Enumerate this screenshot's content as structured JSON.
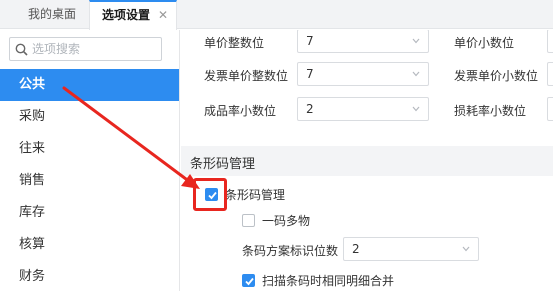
{
  "tabs": {
    "home_label": "我的桌面",
    "active_label": "选项设置",
    "close_glyph": "✕"
  },
  "sidebar": {
    "search_placeholder": "选项搜索",
    "items": [
      {
        "label": "公共",
        "active": true
      },
      {
        "label": "采购",
        "active": false
      },
      {
        "label": "往来",
        "active": false
      },
      {
        "label": "销售",
        "active": false
      },
      {
        "label": "库存",
        "active": false
      },
      {
        "label": "核算",
        "active": false
      },
      {
        "label": "财务",
        "active": false
      }
    ]
  },
  "settings": {
    "rows": [
      {
        "label": "单价整数位",
        "value": "7",
        "right_label": "单价小数位"
      },
      {
        "label": "发票单价整数位",
        "value": "7",
        "right_label": "发票单价小数位"
      },
      {
        "label": "成品率小数位",
        "value": "2",
        "right_label": "损耗率小数位"
      }
    ],
    "barcode_section": {
      "title": "条形码管理",
      "enable_label": "条形码管理",
      "enable_checked": true,
      "one_code_multi_label": "一码多物",
      "one_code_multi_checked": false,
      "scheme_digits_label": "条码方案标识位数",
      "scheme_digits_value": "2",
      "merge_label": "扫描条码时相同明细合并",
      "merge_checked": true
    }
  },
  "colors": {
    "accent": "#2d8cf0",
    "annotation_red": "#e8261f"
  }
}
